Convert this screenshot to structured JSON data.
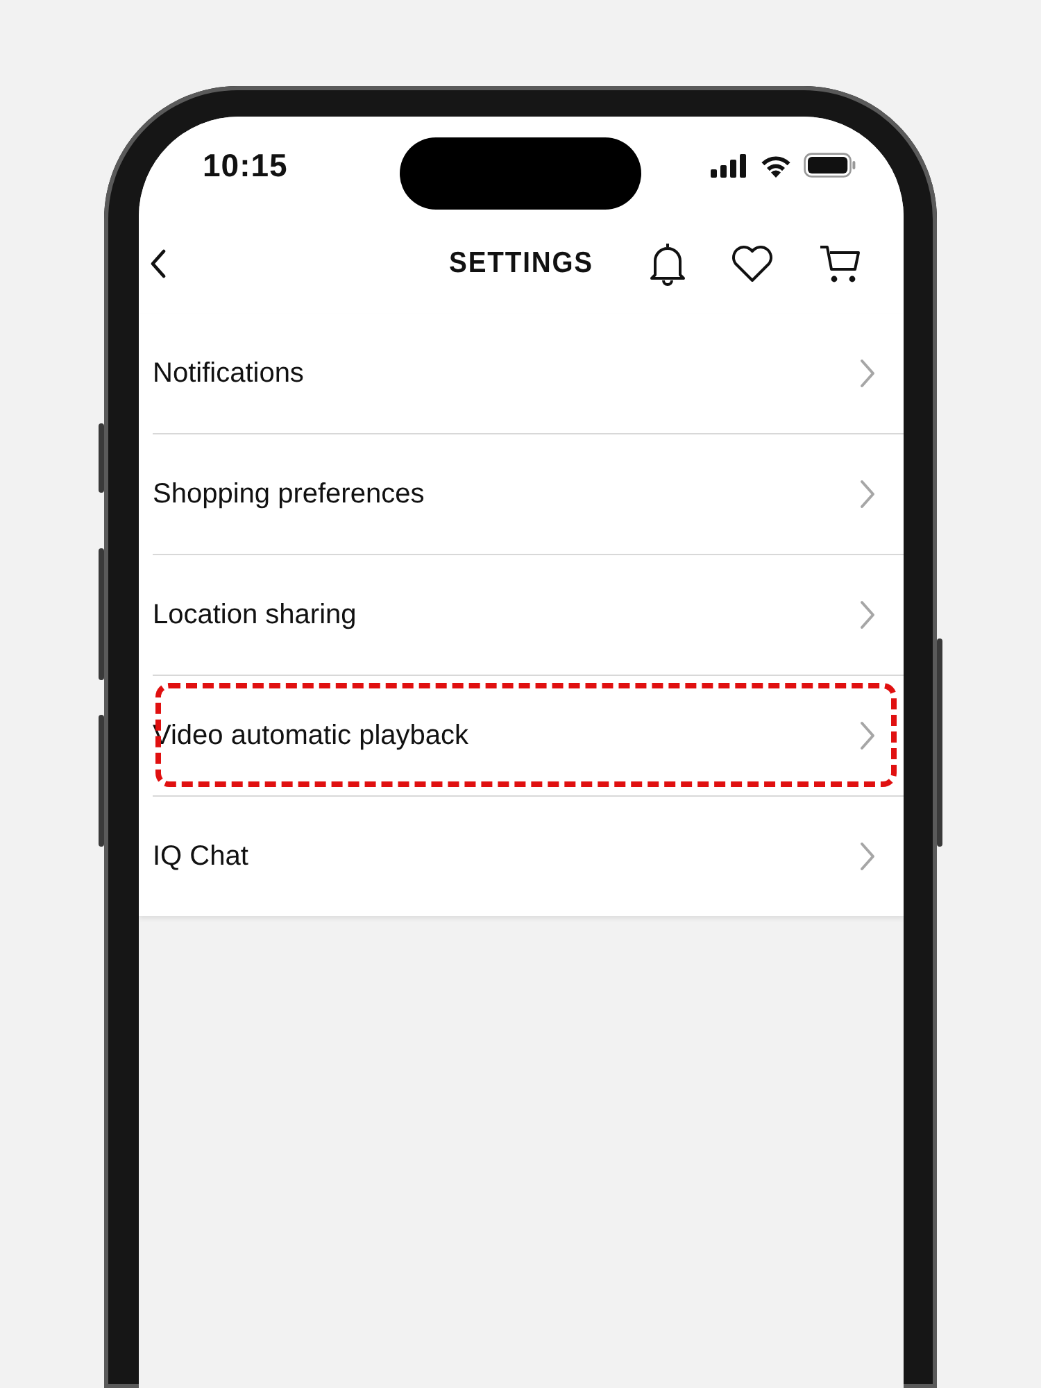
{
  "status_bar": {
    "time": "10:15"
  },
  "header": {
    "title": "SETTINGS"
  },
  "items": [
    {
      "label": "Notifications",
      "highlighted": false
    },
    {
      "label": "Shopping preferences",
      "highlighted": false
    },
    {
      "label": "Location sharing",
      "highlighted": false
    },
    {
      "label": "Video automatic playback",
      "highlighted": true
    },
    {
      "label": "IQ Chat",
      "highlighted": false
    }
  ]
}
